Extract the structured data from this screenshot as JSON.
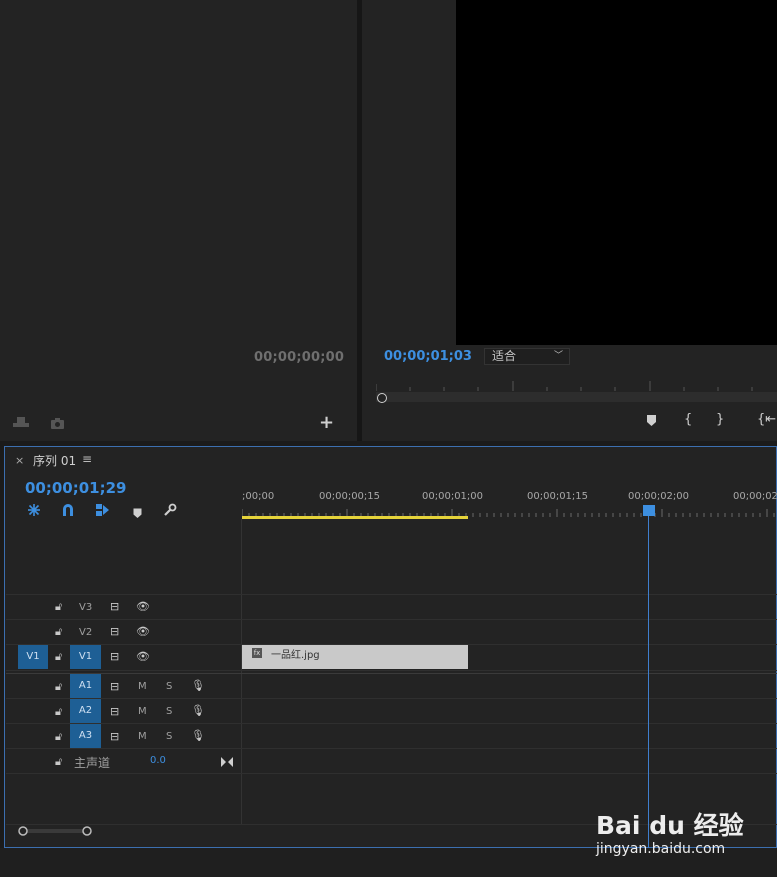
{
  "source_monitor": {
    "timecode": "00;00;00;00",
    "insert_icon": "insert-icon",
    "camera_icon": "camera-icon",
    "add_icon": "plus-icon",
    "add_label": "+"
  },
  "program_monitor": {
    "timecode": "00;00;01;03",
    "fit_select": {
      "value": "适合",
      "icon": "chevron-down-icon"
    },
    "controls": [
      {
        "name": "add-marker-button",
        "icon": "marker-icon",
        "glyph": "⬟"
      },
      {
        "name": "mark-in-button",
        "icon": "mark-in-icon",
        "glyph": "{"
      },
      {
        "name": "mark-out-button",
        "icon": "mark-out-icon",
        "glyph": "}"
      },
      {
        "name": "go-to-in-button",
        "icon": "go-to-in-icon",
        "glyph": "{⇤"
      }
    ]
  },
  "timeline": {
    "close_label": "×",
    "sequence_name": "序列 01",
    "menu_label": "≡",
    "timecode": "00;00;01;29",
    "ruler_labels": [
      ";00;00",
      "00;00;00;15",
      "00;00;01;00",
      "00;00;01;15",
      "00;00;02;00",
      "00;00;02;"
    ],
    "tools": [
      {
        "name": "nest-toggle",
        "icon": "nest-icon"
      },
      {
        "name": "snap-toggle",
        "icon": "magnet-icon"
      },
      {
        "name": "linked-selection-toggle",
        "icon": "linked-selection-icon"
      },
      {
        "name": "add-marker-button",
        "icon": "marker-icon"
      },
      {
        "name": "timeline-settings-button",
        "icon": "wrench-icon"
      }
    ],
    "video_tracks": [
      {
        "id": "V3",
        "source_patch": ""
      },
      {
        "id": "V2",
        "source_patch": ""
      },
      {
        "id": "V1",
        "source_patch": "V1"
      }
    ],
    "audio_tracks": [
      {
        "id": "A1",
        "mute": "M",
        "solo": "S"
      },
      {
        "id": "A2",
        "mute": "M",
        "solo": "S"
      },
      {
        "id": "A3",
        "mute": "M",
        "solo": "S"
      }
    ],
    "master": {
      "label": "主声道",
      "value": "0.0"
    },
    "clip": {
      "name": "一品红.jpg",
      "fx_label": "fx"
    }
  },
  "watermark": {
    "brand": "Bai du 经验",
    "url": "jingyan.baidu.com"
  }
}
